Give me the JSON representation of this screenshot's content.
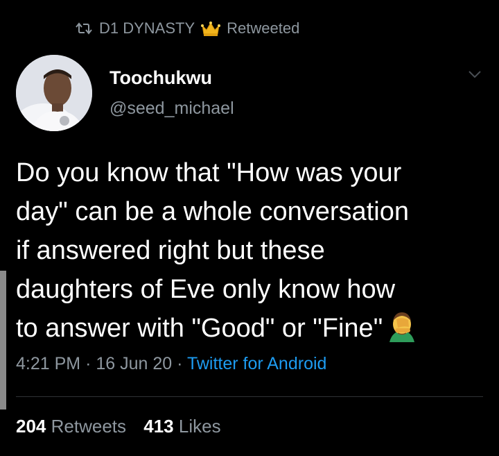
{
  "retweet_banner": {
    "name": "D1 DYNASTY",
    "action": "Retweeted"
  },
  "author": {
    "display_name": "Toochukwu",
    "handle": "@seed_michael"
  },
  "tweet": {
    "lines": [
      "Do you know that \"How was your",
      "day\" can be a whole conversation",
      "if answered right but these",
      "daughters of Eve only know how",
      "to answer with \"Good\" or \"Fine\""
    ],
    "emoji": "man-facepalming-emoji"
  },
  "meta": {
    "time": "4:21 PM",
    "separator": "·",
    "date": "16 Jun 20",
    "source": "Twitter for Android"
  },
  "stats": {
    "retweets_count": "204",
    "retweets_label": "Retweets",
    "likes_count": "413",
    "likes_label": "Likes"
  },
  "colors": {
    "background": "#000000",
    "text": "#ffffff",
    "secondary": "#8e979f",
    "link": "#1d9bf0"
  }
}
